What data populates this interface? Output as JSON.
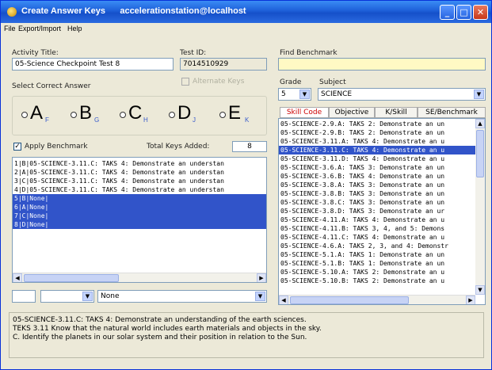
{
  "window": {
    "title": "Create Answer Keys",
    "host": "accelerationstation@localhost",
    "controls": [
      "minimize",
      "maximize",
      "close"
    ]
  },
  "menu": [
    "File",
    "Export/Import",
    "Help"
  ],
  "activity": {
    "label": "Activity Title:",
    "value": "05-Science Checkpoint Test 8"
  },
  "test": {
    "label": "Test ID:",
    "value": "7014510929"
  },
  "alternate_keys": {
    "label": "Alternate Keys",
    "checked": false
  },
  "find": {
    "label": "Find Benchmark",
    "value": ""
  },
  "grade": {
    "label": "Grade",
    "value": "5"
  },
  "subject": {
    "label": "Subject",
    "value": "SCIENCE"
  },
  "answer": {
    "label": "Select Correct Answer",
    "options": [
      {
        "letter": "A",
        "sub": "F"
      },
      {
        "letter": "B",
        "sub": "G"
      },
      {
        "letter": "C",
        "sub": "H"
      },
      {
        "letter": "D",
        "sub": "J"
      },
      {
        "letter": "E",
        "sub": "K"
      }
    ]
  },
  "apply_benchmark": {
    "label": "Apply Benchmark",
    "checked": true
  },
  "total_keys": {
    "label": "Total Keys Added:",
    "value": "8"
  },
  "keys_list": [
    {
      "text": "1|B|05-SCIENCE-3.11.C: TAKS 4: Demonstrate an understan",
      "selected": false
    },
    {
      "text": "2|A|05-SCIENCE-3.11.C: TAKS 4: Demonstrate an understan",
      "selected": false
    },
    {
      "text": "3|C|05-SCIENCE-3.11.C: TAKS 4: Demonstrate an understan",
      "selected": false
    },
    {
      "text": "4|D|05-SCIENCE-3.11.C: TAKS 4: Demonstrate an understan",
      "selected": false
    },
    {
      "text": "5|B|None|",
      "selected": true
    },
    {
      "text": "6|A|None|",
      "selected": true
    },
    {
      "text": "7|C|None|",
      "selected": true
    },
    {
      "text": "8|D|None|",
      "selected": true
    }
  ],
  "bottom_combo": {
    "value": "None"
  },
  "benchmark_tabs": [
    "Skill Code",
    "Objective",
    "K/Skill",
    "SE/Benchmark"
  ],
  "benchmark_list": [
    {
      "text": "05-SCIENCE-2.9.A: TAKS 2: Demonstrate an un",
      "highlighted": false
    },
    {
      "text": "05-SCIENCE-2.9.B: TAKS 2: Demonstrate an un",
      "highlighted": false
    },
    {
      "text": "05-SCIENCE-3.11.A: TAKS 4: Demonstrate an u",
      "highlighted": false
    },
    {
      "text": "05-SCIENCE-3.11.C: TAKS 4: Demonstrate an u",
      "highlighted": true
    },
    {
      "text": "05-SCIENCE-3.11.D: TAKS 4: Demonstrate an u",
      "highlighted": false
    },
    {
      "text": "05-SCIENCE-3.6.A: TAKS 3: Demonstrate an un",
      "highlighted": false
    },
    {
      "text": "05-SCIENCE-3.6.B: TAKS 4: Demonstrate an un",
      "highlighted": false
    },
    {
      "text": "05-SCIENCE-3.8.A: TAKS 3: Demonstrate an un",
      "highlighted": false
    },
    {
      "text": "05-SCIENCE-3.8.B: TAKS 3: Demonstrate an un",
      "highlighted": false
    },
    {
      "text": "05-SCIENCE-3.8.C: TAKS 3: Demonstrate an un",
      "highlighted": false
    },
    {
      "text": "05-SCIENCE-3.8.D: TAKS 3: Demonstrate an ur",
      "highlighted": false
    },
    {
      "text": "05-SCIENCE-4.11.A: TAKS 4: Demonstrate an u",
      "highlighted": false
    },
    {
      "text": "05-SCIENCE-4.11.B: TAKS 3, 4, and 5: Demons",
      "highlighted": false
    },
    {
      "text": "05-SCIENCE-4.11.C: TAKS 4: Demonstrate an u",
      "highlighted": false
    },
    {
      "text": "05-SCIENCE-4.6.A: TAKS 2, 3, and 4: Demonstr",
      "highlighted": false
    },
    {
      "text": "05-SCIENCE-5.1.A: TAKS 1: Demonstrate an un",
      "highlighted": false
    },
    {
      "text": "05-SCIENCE-5.1.B: TAKS 1: Demonstrate an un",
      "highlighted": false
    },
    {
      "text": "05-SCIENCE-5.10.A: TAKS 2: Demonstrate an u",
      "highlighted": false
    },
    {
      "text": "05-SCIENCE-5.10.B: TAKS 2: Demonstrate an u",
      "highlighted": false
    }
  ],
  "description": [
    "05-SCIENCE-3.11.C: TAKS 4: Demonstrate an understanding of the earth sciences.",
    "TEKS 3.11 Know that the natural world includes earth materials and objects in the sky.",
    "C. Identify the planets in our solar system and their position in relation to the Sun."
  ]
}
